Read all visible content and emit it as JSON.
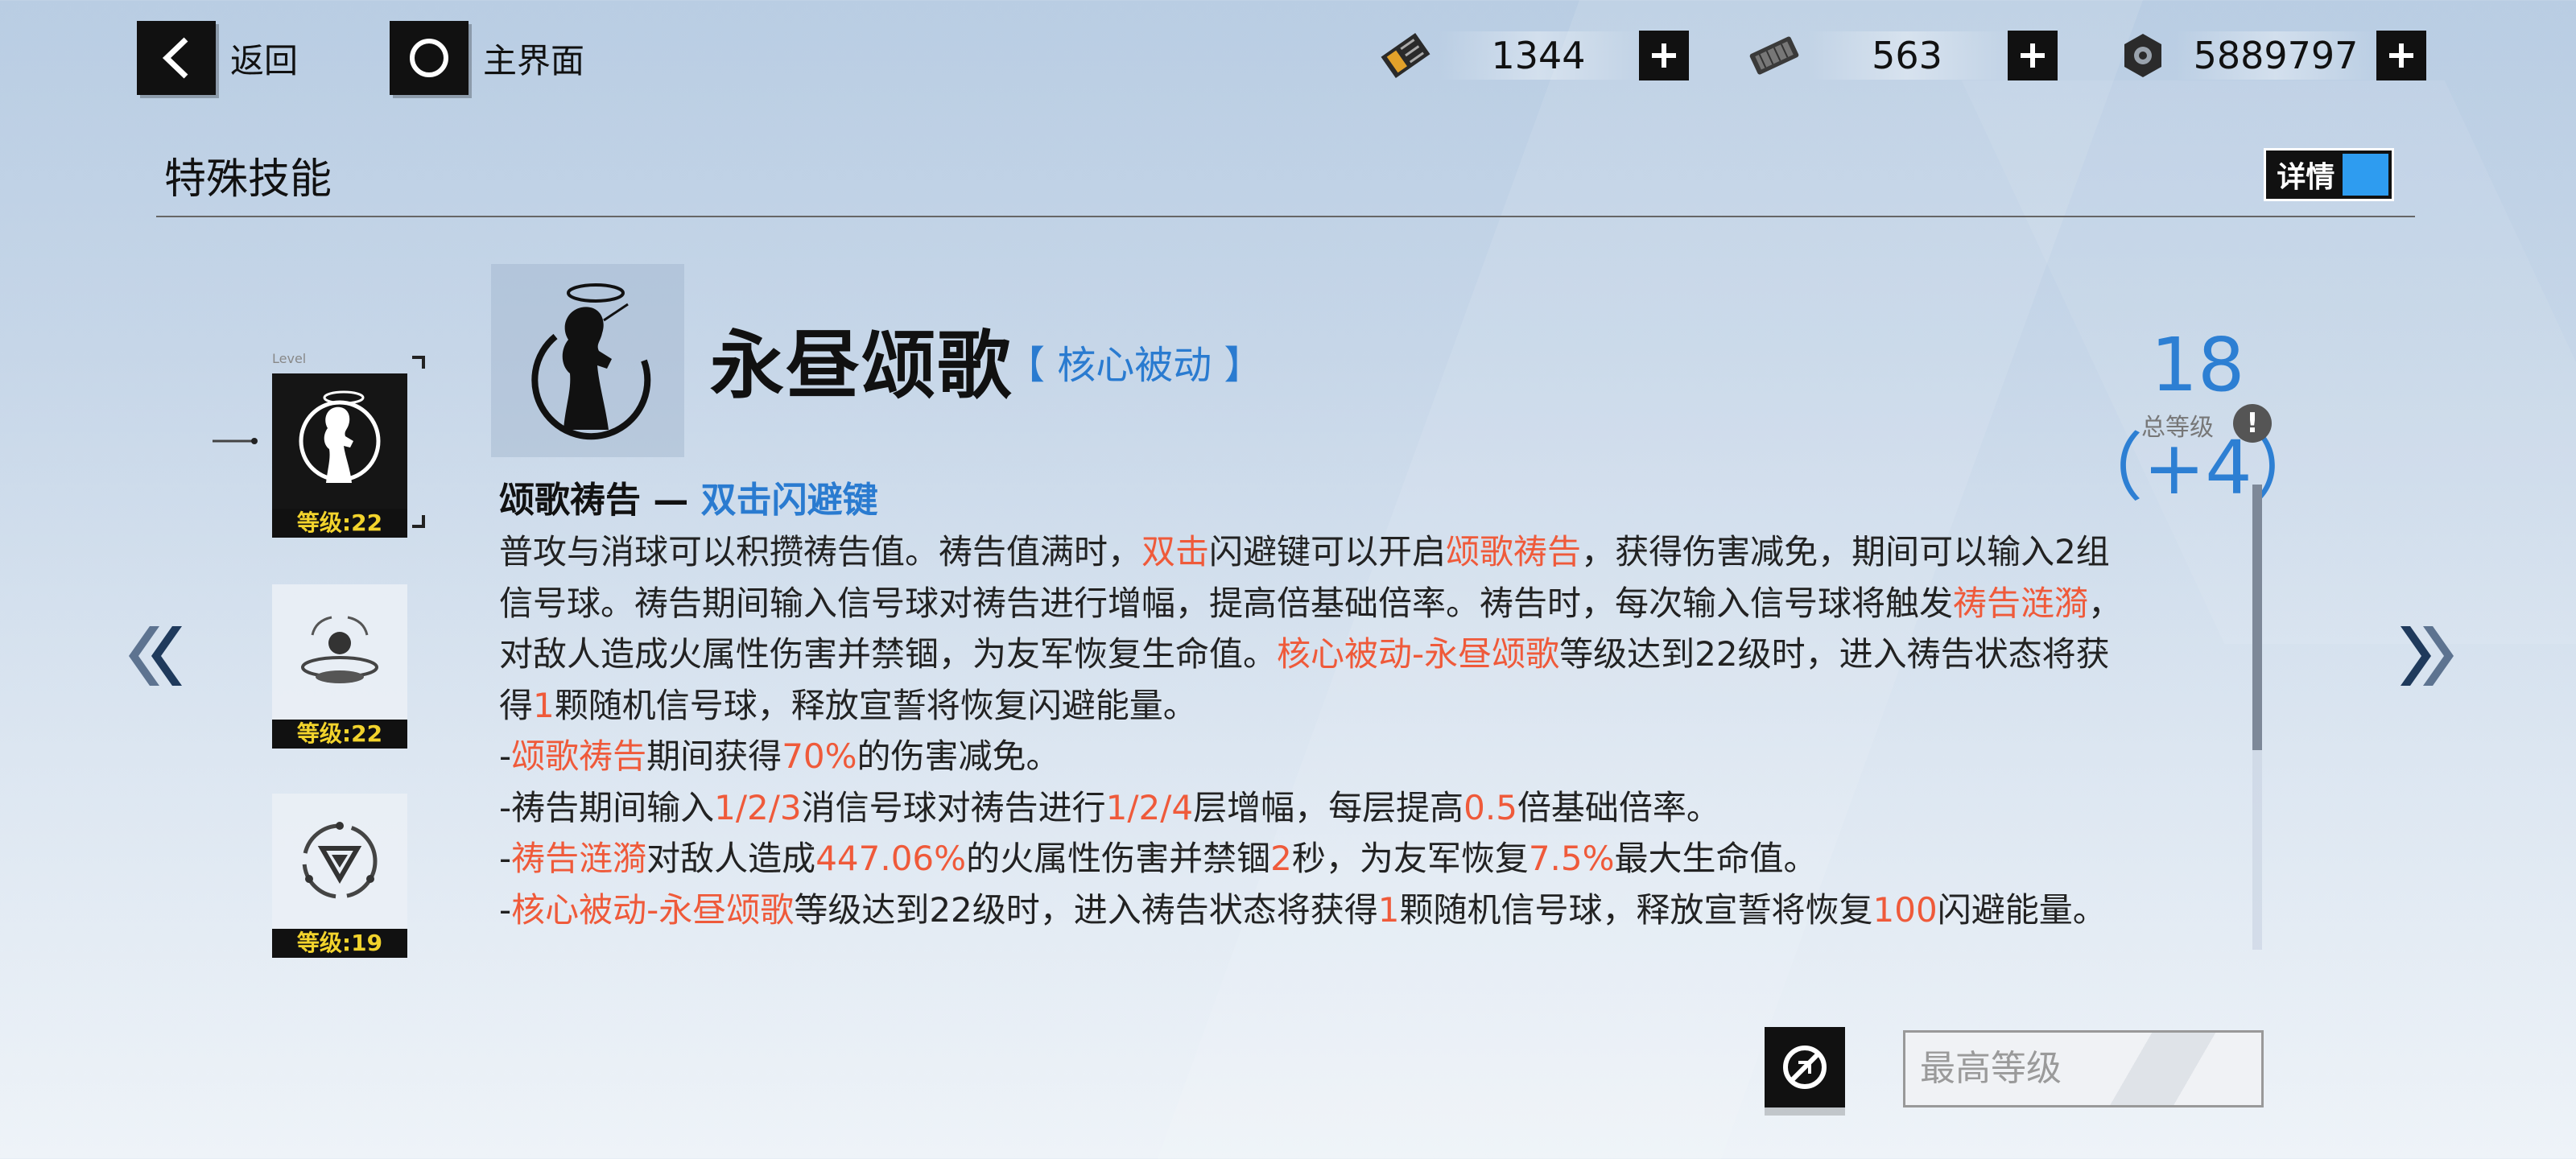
{
  "nav": {
    "back_label": "返回",
    "home_label": "主界面"
  },
  "resources": [
    {
      "icon": "ticket-icon",
      "value": "1344"
    },
    {
      "icon": "chip-icon",
      "value": "563"
    },
    {
      "icon": "gear-nut-icon",
      "value": "5889797"
    }
  ],
  "section": {
    "title": "特殊技能",
    "detail_label": "详情"
  },
  "skill_list": {
    "level_tag": "Level",
    "items": [
      {
        "icon": "angel-silhouette-icon",
        "level": "等级:22",
        "selected": true
      },
      {
        "icon": "orb-platform-icon",
        "level": "等级:22",
        "selected": false
      },
      {
        "icon": "triangle-ring-icon",
        "level": "等级:19",
        "selected": false
      }
    ]
  },
  "skill": {
    "name": "永昼颂歌",
    "type": "【 核心被动 】",
    "total_level": "18（+4）",
    "total_level_label": "总等级",
    "info": "!"
  },
  "description": {
    "sub_title_prefix": "颂歌祷告 — ",
    "sub_title_key": "双击闪避键",
    "lines": [
      [
        {
          "t": "普攻与消球可以积攒祷告值。祷告值满时，"
        },
        {
          "t": "双击",
          "h": true
        },
        {
          "t": "闪避键可以开启"
        },
        {
          "t": "颂歌祷告",
          "h": true
        },
        {
          "t": "，获得伤害减免，期间可以输入2组"
        }
      ],
      [
        {
          "t": "信号球。祷告期间输入信号球对祷告进行增幅，提高倍基础倍率。祷告时，每次输入信号球将触发"
        },
        {
          "t": "祷告涟漪",
          "h": true
        },
        {
          "t": "，"
        }
      ],
      [
        {
          "t": "对敌人造成火属性伤害并禁锢，为友军恢复生命值。"
        },
        {
          "t": "核心被动-永昼颂歌",
          "h": true
        },
        {
          "t": "等级达到22级时，进入祷告状态将获"
        }
      ],
      [
        {
          "t": "得"
        },
        {
          "t": "1",
          "h": true
        },
        {
          "t": "颗随机信号球，释放宣誓将恢复闪避能量。"
        }
      ],
      [
        {
          "t": "-"
        },
        {
          "t": "颂歌祷告",
          "h": true
        },
        {
          "t": "期间获得"
        },
        {
          "t": "70%",
          "h": true
        },
        {
          "t": "的伤害减免。"
        }
      ],
      [
        {
          "t": "-祷告期间输入"
        },
        {
          "t": "1/2/3",
          "h": true
        },
        {
          "t": "消信号球对祷告进行"
        },
        {
          "t": "1/2/4",
          "h": true
        },
        {
          "t": "层增幅，每层提高"
        },
        {
          "t": "0.5",
          "h": true
        },
        {
          "t": "倍基础倍率。"
        }
      ],
      [
        {
          "t": "-"
        },
        {
          "t": "祷告涟漪",
          "h": true
        },
        {
          "t": "对敌人造成"
        },
        {
          "t": "447.06%",
          "h": true
        },
        {
          "t": "的火属性伤害并禁锢"
        },
        {
          "t": "2",
          "h": true
        },
        {
          "t": "秒，为友军恢复"
        },
        {
          "t": "7.5%",
          "h": true
        },
        {
          "t": "最大生命值。"
        }
      ],
      [
        {
          "t": "-"
        },
        {
          "t": "核心被动-永昼颂歌",
          "h": true
        },
        {
          "t": "等级达到22级时，进入祷告状态将获得"
        },
        {
          "t": "1",
          "h": true
        },
        {
          "t": "颗随机信号球，释放宣誓将恢复"
        },
        {
          "t": "100",
          "h": true
        },
        {
          "t": "闪避能量。"
        }
      ]
    ]
  },
  "bottom": {
    "max_level_label": "最高等级"
  },
  "colors": {
    "accent_blue": "#2a7bd0",
    "highlight_red": "#ef5a3a",
    "level_yellow": "#f2d32c"
  }
}
